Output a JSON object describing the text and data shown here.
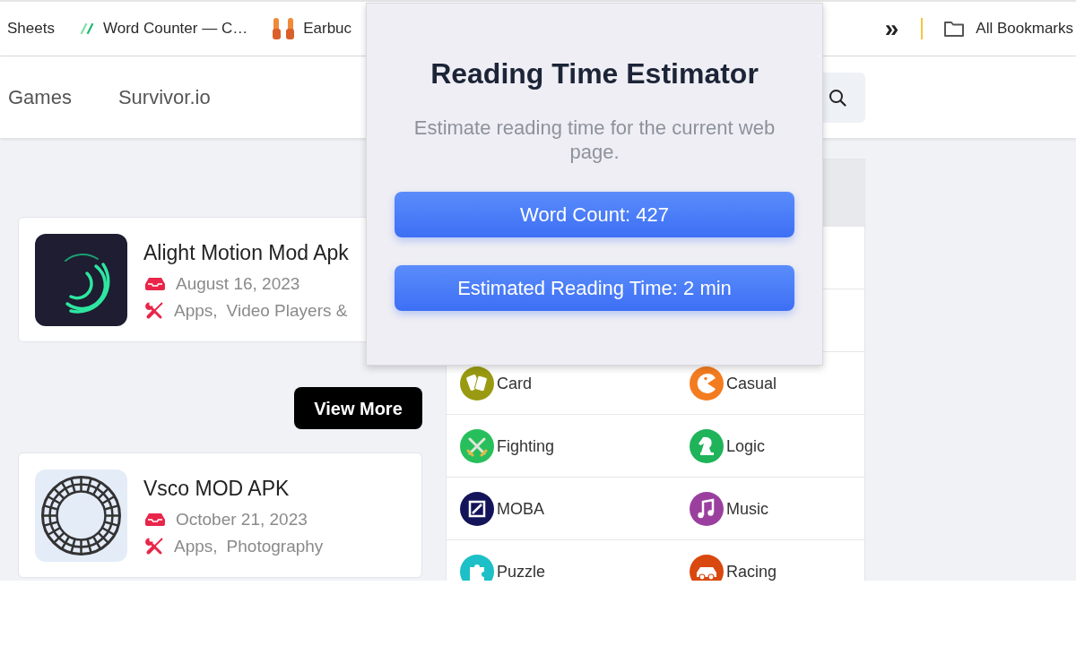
{
  "bookmarks_bar": {
    "items": [
      {
        "label": "Sheets"
      },
      {
        "label": "Word Counter — C…"
      },
      {
        "label": "Earbuc"
      }
    ],
    "overflow_button": "»",
    "all_bookmarks": "All Bookmarks"
  },
  "site_nav": {
    "links": [
      "Games",
      "Survivor.io"
    ]
  },
  "main_column": [
    {
      "kind": "post",
      "title": "Alight Motion Mod Apk",
      "date": "August 16, 2023",
      "categories": [
        "Apps,",
        "Video Players &"
      ]
    },
    {
      "kind": "button",
      "label": "View More"
    },
    {
      "kind": "post",
      "title": "Vsco MOD APK",
      "date": "October 21, 2023",
      "categories": [
        "Apps,",
        "Photography"
      ]
    }
  ],
  "categories": [
    {
      "label": "Card",
      "color": "#9a9a12"
    },
    {
      "label": "Casual",
      "color": "#f47c20"
    },
    {
      "label": "Fighting",
      "color": "#27bf5c"
    },
    {
      "label": "Logic",
      "color": "#1fb35a"
    },
    {
      "label": "MOBA",
      "color": "#14145a"
    },
    {
      "label": "Music",
      "color": "#9b3f9f"
    },
    {
      "label": "Puzzle",
      "color": "#1cc0c6"
    },
    {
      "label": "Racing",
      "color": "#d9480f"
    }
  ],
  "popup": {
    "title": "Reading Time Estimator",
    "description": "Estimate reading time for the current web page.",
    "buttons": [
      "Word Count: 427",
      "Estimated Reading Time: 2 min"
    ]
  }
}
